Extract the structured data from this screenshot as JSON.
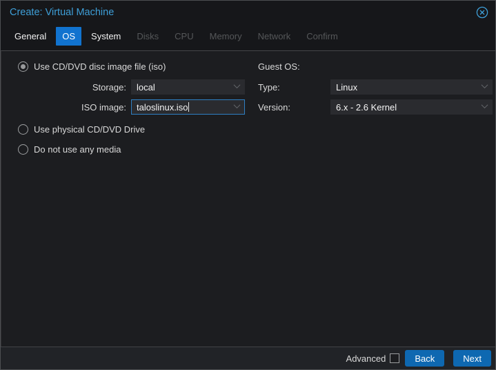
{
  "window": {
    "title": "Create: Virtual Machine"
  },
  "tabs": [
    {
      "label": "General",
      "state": "normal"
    },
    {
      "label": "OS",
      "state": "active"
    },
    {
      "label": "System",
      "state": "normal"
    },
    {
      "label": "Disks",
      "state": "disabled"
    },
    {
      "label": "CPU",
      "state": "disabled"
    },
    {
      "label": "Memory",
      "state": "disabled"
    },
    {
      "label": "Network",
      "state": "disabled"
    },
    {
      "label": "Confirm",
      "state": "disabled"
    }
  ],
  "form": {
    "media": {
      "iso_radio": {
        "label": "Use CD/DVD disc image file (iso)",
        "selected": true
      },
      "storage": {
        "label": "Storage:",
        "value": "local"
      },
      "iso_image": {
        "label": "ISO image:",
        "value": "taloslinux.iso",
        "focused": true
      },
      "physical_radio": {
        "label": "Use physical CD/DVD Drive",
        "selected": false
      },
      "no_media_radio": {
        "label": "Do not use any media",
        "selected": false
      }
    },
    "guest_os": {
      "header": "Guest OS:",
      "type": {
        "label": "Type:",
        "value": "Linux"
      },
      "version": {
        "label": "Version:",
        "value": "6.x - 2.6 Kernel"
      }
    }
  },
  "footer": {
    "advanced_label": "Advanced",
    "advanced_checked": false,
    "back_label": "Back",
    "next_label": "Next"
  },
  "colors": {
    "title_accent": "#3e9fd8",
    "active_tab": "#1173cf",
    "button": "#0e68b1",
    "focus_border": "#2f80c4",
    "body_bg": "#1c1d20",
    "header_bg": "#16171a",
    "field_bg": "#2a2b2f"
  }
}
